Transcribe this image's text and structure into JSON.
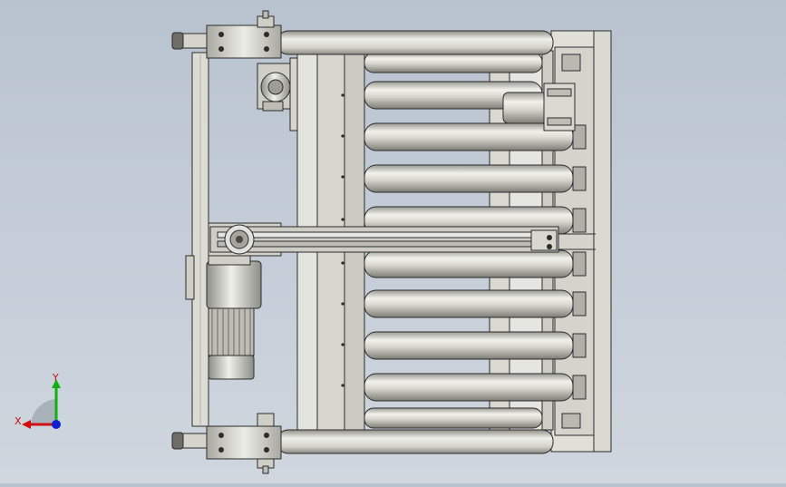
{
  "viewport": {
    "background_top": "#b9c3cf",
    "background_bottom": "#cfd6de"
  },
  "colors": {
    "steel_light": "#e8e8e2",
    "steel_mid": "#c9c9c1",
    "steel_dark": "#8d8d86",
    "outline": "#2b2b2b",
    "axis_x": "#d01010",
    "axis_y": "#10b010",
    "axis_z": "#1020d0"
  },
  "triad": {
    "x_label": "X",
    "y_label": "Y",
    "icons": [
      "axis-triad-icon"
    ]
  }
}
